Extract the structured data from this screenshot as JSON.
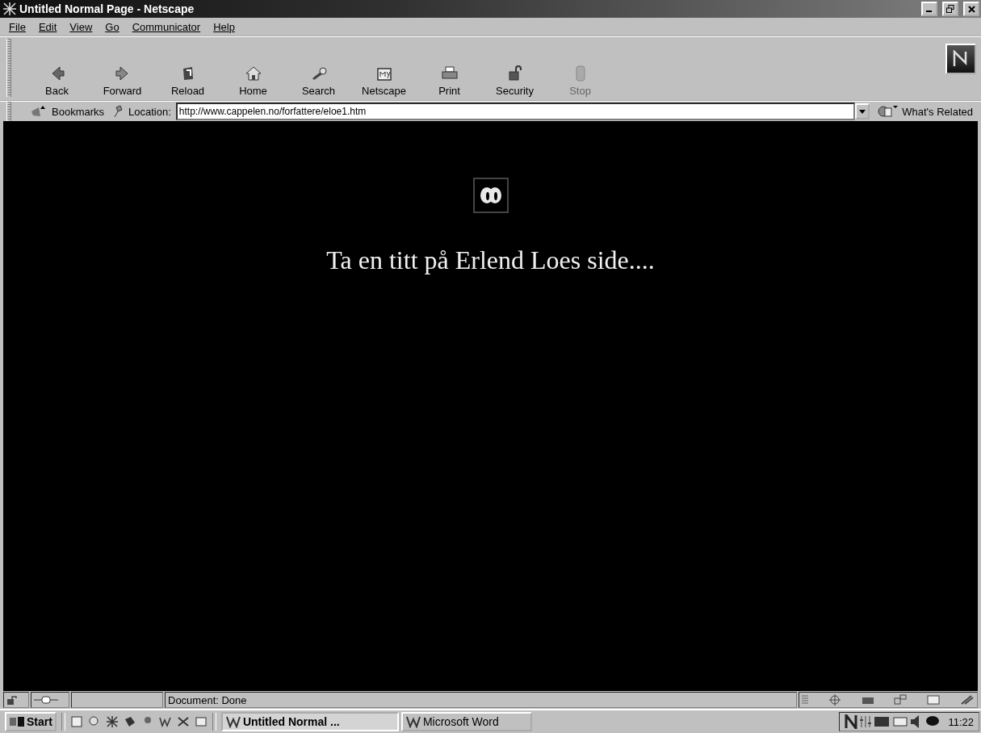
{
  "window": {
    "title": "Untitled Normal Page - Netscape"
  },
  "menu": [
    "File",
    "Edit",
    "View",
    "Go",
    "Communicator",
    "Help"
  ],
  "toolbar": [
    {
      "label": "Back",
      "kind": "back",
      "disabled": false
    },
    {
      "label": "Forward",
      "kind": "forward",
      "disabled": false
    },
    {
      "label": "Reload",
      "kind": "reload",
      "disabled": false
    },
    {
      "label": "Home",
      "kind": "home",
      "disabled": false
    },
    {
      "label": "Search",
      "kind": "search",
      "disabled": false
    },
    {
      "label": "Netscape",
      "kind": "netscape",
      "disabled": false
    },
    {
      "label": "Print",
      "kind": "print",
      "disabled": false
    },
    {
      "label": "Security",
      "kind": "security",
      "disabled": false
    },
    {
      "label": "Stop",
      "kind": "stop",
      "disabled": true
    }
  ],
  "location_bar": {
    "bookmarks": "Bookmarks",
    "location_label": "Location:",
    "url": "http://www.cappelen.no/forfattere/eloe1.htm",
    "whats_related": "What's Related"
  },
  "page": {
    "heading": "Ta en titt på Erlend Loes side...."
  },
  "status_bar": {
    "text": "Document: Done"
  },
  "taskbar": {
    "start": "Start",
    "tasks": [
      {
        "label": "Untitled Normal ...",
        "selected": true
      },
      {
        "label": "Microsoft Word",
        "selected": false
      }
    ],
    "clock": "11:22"
  }
}
